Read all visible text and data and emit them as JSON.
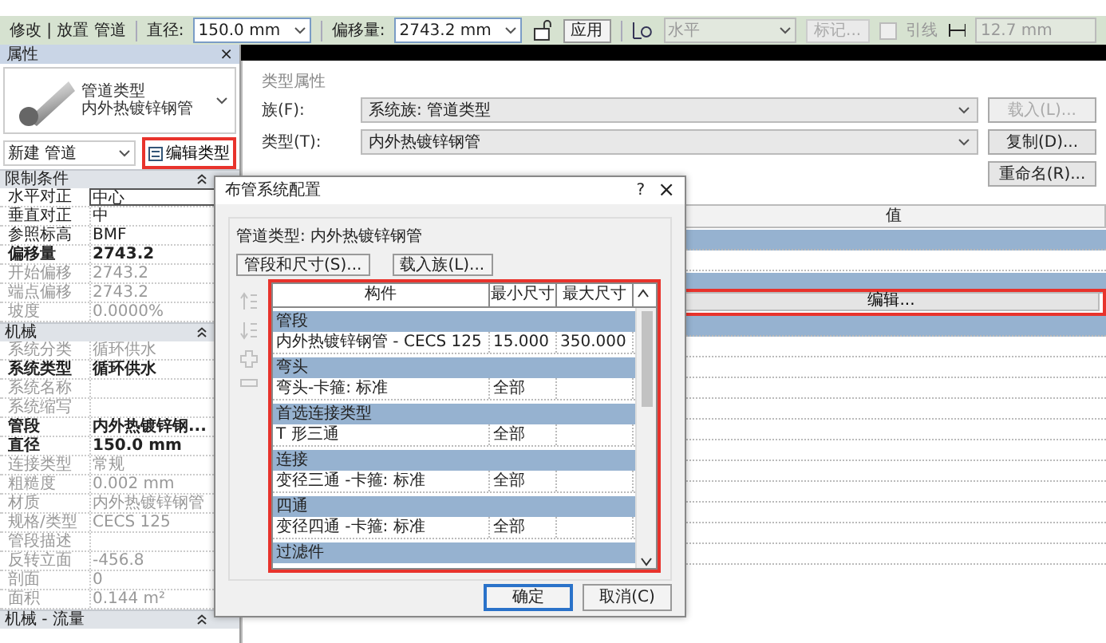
{
  "options_bar": {
    "context": "修改 | 放置 管道",
    "diameter": {
      "label": "直径:",
      "value": "150.0 mm"
    },
    "offset": {
      "label": "偏移量:",
      "value": "2743.2 mm"
    },
    "apply": "应用",
    "justification": {
      "value": "水平",
      "disabled": true
    },
    "tag_button": {
      "label": "标记...",
      "disabled": true
    },
    "leader": {
      "label": "引线",
      "checked": false,
      "disabled": true
    },
    "leader_length": {
      "value": "12.7 mm",
      "disabled": true
    }
  },
  "properties": {
    "title": "属性",
    "close": "×",
    "type_family": "管道类型",
    "type_name": "内外热镀锌钢管",
    "new_selector": "新建 管道",
    "edit_type": {
      "label": "编辑类型",
      "highlighted": true
    },
    "groups": [
      {
        "title": "限制条件",
        "expanded": true,
        "rows": [
          {
            "name": "水平对正",
            "value": "中心",
            "bold": false,
            "disabled": false,
            "focused": true
          },
          {
            "name": "垂直对正",
            "value": "中",
            "bold": false,
            "disabled": false,
            "focused": false
          },
          {
            "name": "参照标高",
            "value": "BMF",
            "bold": false,
            "disabled": false,
            "focused": false
          },
          {
            "name": "偏移量",
            "value": "2743.2",
            "bold": true,
            "disabled": false,
            "focused": false
          },
          {
            "name": "开始偏移",
            "value": "2743.2",
            "bold": false,
            "disabled": true,
            "focused": false
          },
          {
            "name": "端点偏移",
            "value": "2743.2",
            "bold": false,
            "disabled": true,
            "focused": false
          },
          {
            "name": "坡度",
            "value": "0.0000%",
            "bold": false,
            "disabled": true,
            "focused": false
          }
        ]
      },
      {
        "title": "机械",
        "expanded": true,
        "rows": [
          {
            "name": "系统分类",
            "value": "循环供水",
            "bold": false,
            "disabled": true,
            "focused": false
          },
          {
            "name": "系统类型",
            "value": "循环供水",
            "bold": true,
            "disabled": false,
            "focused": false
          },
          {
            "name": "系统名称",
            "bold": false,
            "disabled": true,
            "focused": false
          },
          {
            "name": "系统缩写",
            "bold": false,
            "disabled": true,
            "focused": false
          },
          {
            "name": "管段",
            "value": "内外热镀锌钢...",
            "bold": true,
            "disabled": false,
            "focused": false
          },
          {
            "name": "直径",
            "value": "150.0 mm",
            "bold": true,
            "disabled": false,
            "focused": false
          },
          {
            "name": "连接类型",
            "value": "常规",
            "bold": false,
            "disabled": true,
            "focused": false
          },
          {
            "name": "粗糙度",
            "value": "0.002 mm",
            "bold": false,
            "disabled": true,
            "focused": false
          },
          {
            "name": "材质",
            "value": "内外热镀锌钢管",
            "bold": false,
            "disabled": true,
            "focused": false
          },
          {
            "name": "规格/类型",
            "value": "CECS 125",
            "bold": false,
            "disabled": true,
            "focused": false
          },
          {
            "name": "管段描述",
            "bold": false,
            "disabled": true,
            "focused": false
          },
          {
            "name": "反转立面",
            "value": "-456.8",
            "bold": false,
            "disabled": true,
            "focused": false
          },
          {
            "name": "剖面",
            "value": "0",
            "bold": false,
            "disabled": true,
            "focused": false
          },
          {
            "name": "面积",
            "value": "0.144 m²",
            "bold": false,
            "disabled": true,
            "focused": false
          }
        ]
      },
      {
        "title": "机械 - 流量",
        "expanded": true
      }
    ]
  },
  "type_properties": {
    "title": "类型属性",
    "family": {
      "label": "族(F):",
      "value": "系统族: 管道类型"
    },
    "type": {
      "label": "类型(T):",
      "value": "内外热镀锌钢管"
    },
    "buttons": [
      {
        "label": "载入(L)...",
        "disabled": true
      },
      {
        "label": "复制(D)...",
        "disabled": false
      },
      {
        "label": "重命名(R)...",
        "disabled": false
      }
    ],
    "table": {
      "value_header": "值",
      "rows": [
        {
          "kind": "group"
        },
        {
          "kind": "empty"
        },
        {
          "kind": "group"
        },
        {
          "kind": "button",
          "label": "编辑...",
          "highlighted": true
        },
        {
          "kind": "group"
        },
        {
          "kind": "empty"
        },
        {
          "kind": "empty"
        },
        {
          "kind": "empty"
        },
        {
          "kind": "empty"
        },
        {
          "kind": "empty"
        },
        {
          "kind": "empty"
        },
        {
          "kind": "empty"
        },
        {
          "kind": "empty"
        },
        {
          "kind": "empty"
        },
        {
          "kind": "empty"
        },
        {
          "kind": "empty"
        }
      ]
    }
  },
  "dialog": {
    "title": "布管系统配置",
    "help": "?",
    "close": "×",
    "pipe_type": "管道类型: 内外热镀锌钢管",
    "buttons": [
      "管段和尺寸(S)...",
      "载入族(L)..."
    ],
    "tools": [
      {
        "kind": "move-up",
        "disabled": true
      },
      {
        "kind": "move-down",
        "disabled": true
      },
      {
        "kind": "add",
        "disabled": true
      },
      {
        "kind": "remove",
        "disabled": true
      }
    ],
    "columns": [
      "构件",
      "最小尺寸",
      "最大尺寸"
    ],
    "highlighted": true,
    "groups": [
      {
        "title": "管段",
        "rows": [
          {
            "part": "内外热镀锌钢管 - CECS 125",
            "min": "15.000",
            "max": "350.000"
          }
        ]
      },
      {
        "title": "弯头",
        "rows": [
          {
            "part": "弯头-卡箍: 标准",
            "min": "全部"
          }
        ]
      },
      {
        "title": "首选连接类型",
        "rows": [
          {
            "part": "T 形三通",
            "min": "全部"
          }
        ]
      },
      {
        "title": "连接",
        "rows": [
          {
            "part": "变径三通 -卡箍: 标准",
            "min": "全部"
          }
        ]
      },
      {
        "title": "四通",
        "rows": [
          {
            "part": "变径四通 -卡箍: 标准",
            "min": "全部"
          }
        ]
      },
      {
        "title": "过滤件"
      }
    ],
    "ok": "确定",
    "cancel": "取消(C)"
  }
}
